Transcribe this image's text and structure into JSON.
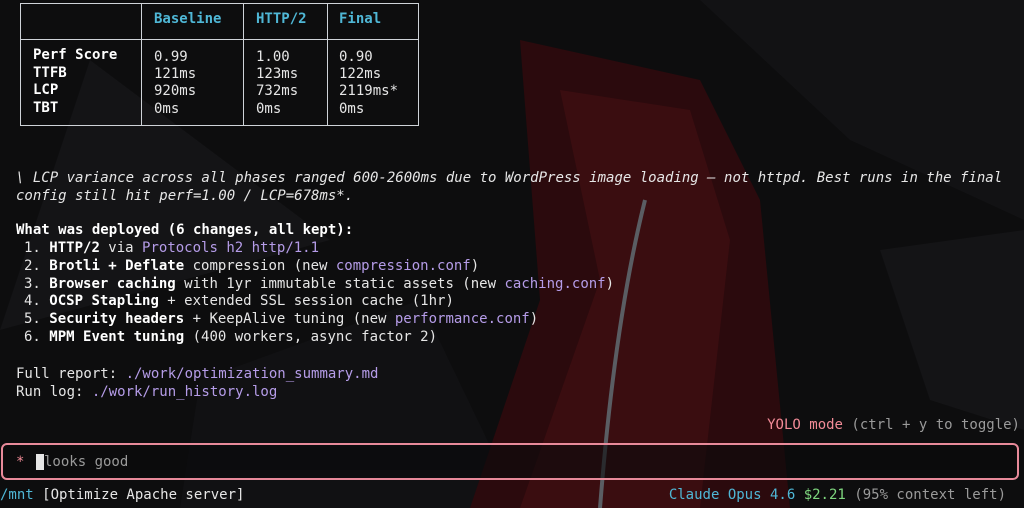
{
  "table": {
    "headers": [
      "Baseline",
      "HTTP/2",
      "Final"
    ],
    "rows": [
      {
        "label": "Perf Score",
        "values": [
          "0.99",
          "1.00",
          "0.90"
        ]
      },
      {
        "label": "TTFB",
        "values": [
          "121ms",
          "123ms",
          "122ms"
        ]
      },
      {
        "label": "LCP",
        "values": [
          "920ms",
          "732ms",
          "2119ms*"
        ]
      },
      {
        "label": "TBT",
        "values": [
          "0ms",
          "0ms",
          "0ms"
        ]
      }
    ]
  },
  "note": "\\ LCP variance across all phases ranged 600-2600ms due to WordPress image loading — not httpd. Best runs in the final config still hit perf=1.00 / LCP=678ms*.",
  "deployed": {
    "heading": "What was deployed (6 changes, all kept):",
    "items": [
      {
        "num": "1.",
        "bold": "HTTP/2",
        "pre": " via ",
        "purple": "Protocols h2 http/1.1",
        "post": ""
      },
      {
        "num": "2.",
        "bold": "Brotli + Deflate",
        "pre": " compression (new ",
        "purple": "compression.conf",
        "post": ")"
      },
      {
        "num": "3.",
        "bold": "Browser caching",
        "pre": " with 1yr immutable static assets (new ",
        "purple": "caching.conf",
        "post": ")"
      },
      {
        "num": "4.",
        "bold": "OCSP Stapling",
        "pre": " + extended SSL session cache (1hr)",
        "purple": "",
        "post": ""
      },
      {
        "num": "5.",
        "bold": "Security headers",
        "pre": " + KeepAlive tuning (new ",
        "purple": "performance.conf",
        "post": ")"
      },
      {
        "num": "6.",
        "bold": "MPM Event tuning",
        "pre": " (400 workers, async factor 2)",
        "purple": "",
        "post": ""
      }
    ]
  },
  "report": {
    "full_label": "Full report: ",
    "full_path": "./work/optimization_summary.md",
    "log_label": "Run log: ",
    "log_path": "./work/run_history.log"
  },
  "yolo": {
    "mode": "YOLO mode",
    "hint": " (ctrl + y to toggle)"
  },
  "input": {
    "prompt": "*",
    "value": "looks good"
  },
  "status": {
    "path": "/mnt",
    "task": " [Optimize Apache server]",
    "model": "Claude Opus 4.6",
    "cost": "$2.21",
    "context": "(95% context left)"
  },
  "colors": {
    "accent_cyan": "#4fb7d6",
    "accent_pink": "#e88a9a",
    "accent_purple": "#b59ce8",
    "cost_green": "#7ed67e",
    "background": "#0d0d0e",
    "bg_shape_red": "#3a0d10"
  }
}
